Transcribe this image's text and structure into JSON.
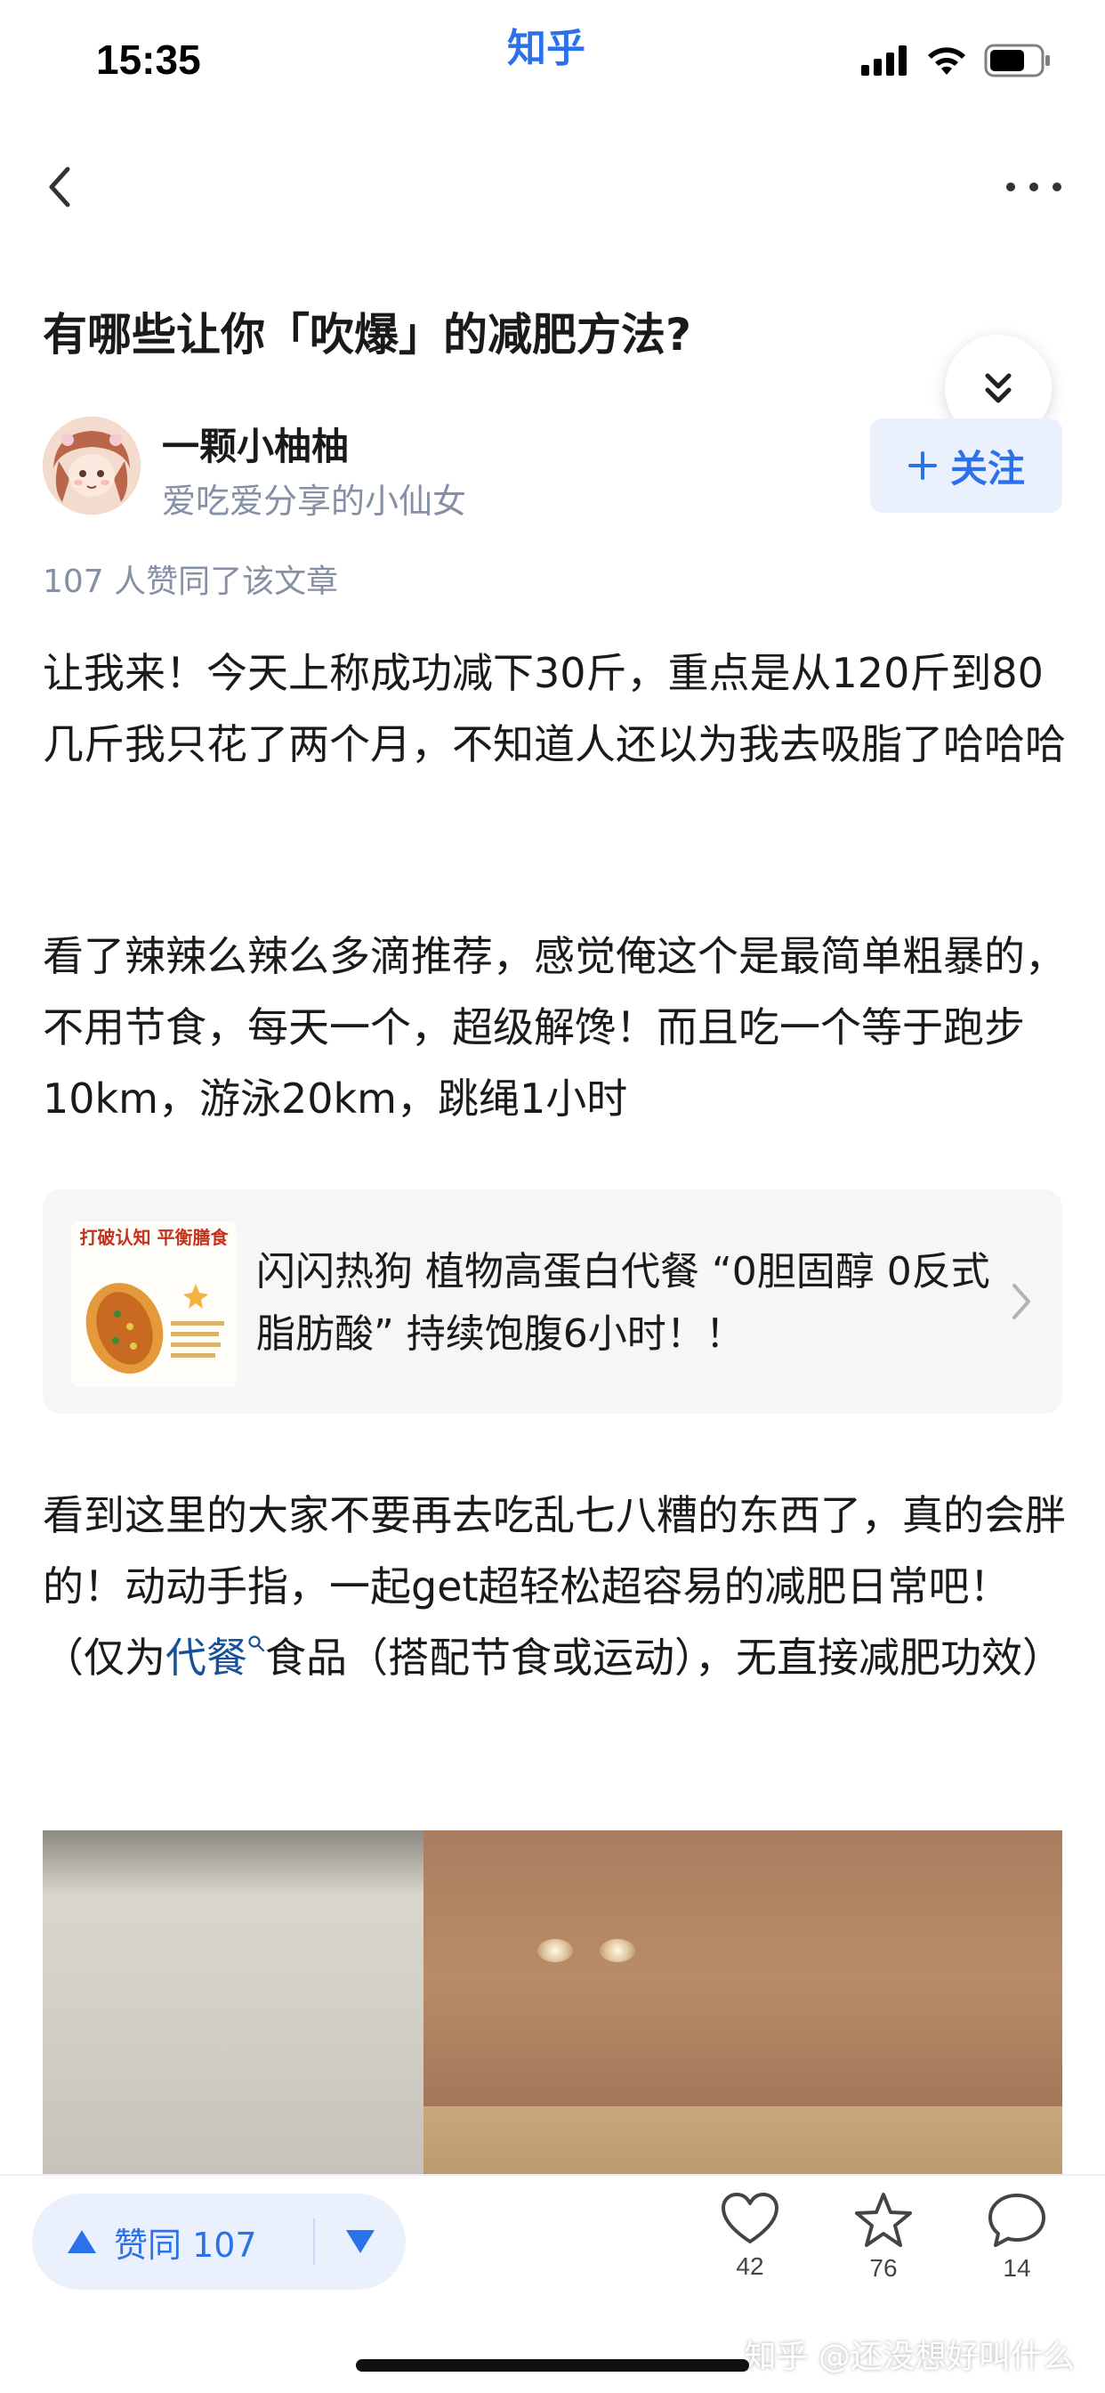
{
  "status_bar": {
    "time": "15:35",
    "app_name": "知乎",
    "icons": [
      "signal-icon",
      "wifi-icon",
      "battery-icon"
    ]
  },
  "nav": {
    "icons": [
      "back-arrow-icon",
      "more-icon"
    ]
  },
  "question": {
    "title": "有哪些让你「吹爆」的减肥方法?"
  },
  "author": {
    "name": "一颗小柚柚",
    "bio": "爱吃爱分享的小仙女",
    "follow_label": "关注"
  },
  "vote_summary": "107 人赞同了该文章",
  "content": {
    "paragraph_1": "让我来！今天上称成功减下30斤，重点是从120斤到80几斤我只花了两个月，不知道人还以为我去吸脂了哈哈哈",
    "paragraph_2": "看了辣辣么辣么多滴推荐，感觉俺这个是最简单粗暴的，不用节食，每天一个，超级解馋！而且吃一个等于跑步10km，游泳20km，跳绳1小时",
    "paragraph_3_before_link": "看到这里的大家不要再去吃乱七八糟的东西了，真的会胖的！动动手指，一起get超轻松超容易的减肥日常吧！（仅为",
    "paragraph_3_link": "代餐",
    "paragraph_3_after_link": "食品（搭配节食或运动），无直接减肥功效）"
  },
  "ad_card": {
    "thumb_tag": "打破认知 平衡膳食",
    "title": "闪闪热狗 植物高蛋白代餐 “0胆固醇 0反式脂肪酸” 持续饱腹6小时！！"
  },
  "bottom_bar": {
    "upvote_label": "赞同 107",
    "like_count": "42",
    "star_count": "76",
    "comment_count": "14"
  },
  "watermark": "知乎 @还没想好叫什么",
  "colors": {
    "brand_blue": "#2b72ea",
    "link_blue": "#175199",
    "meta_gray": "#8590a6",
    "pill_bg": "#ebf1fc"
  }
}
